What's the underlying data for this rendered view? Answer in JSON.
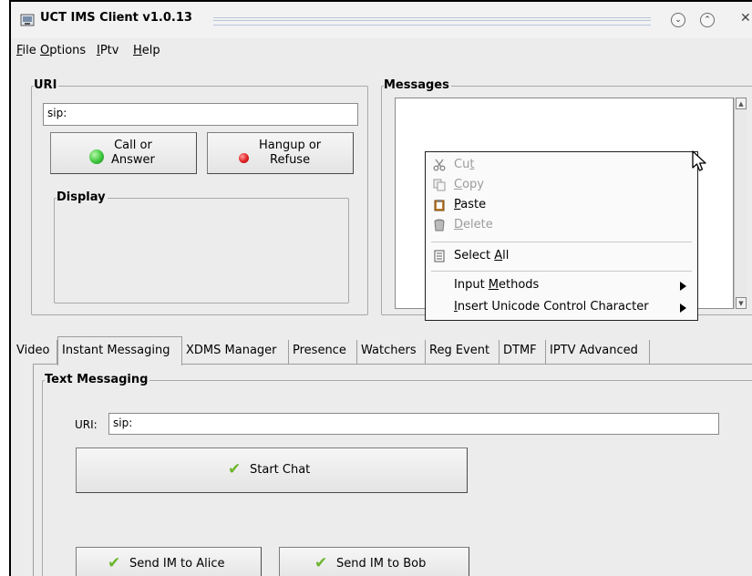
{
  "window": {
    "title": "UCT IMS Client v1.0.13"
  },
  "menubar": {
    "items": [
      {
        "label": "File",
        "mnemonic": "F",
        "rest": "ile"
      },
      {
        "label": "Options",
        "mnemonic": "O",
        "rest": "ptions"
      },
      {
        "label": "IPtv",
        "mnemonic": "I",
        "rest": "Ptv"
      },
      {
        "label": "Help",
        "mnemonic": "H",
        "rest": "elp"
      }
    ]
  },
  "uri_group": {
    "title": "URI",
    "uri_value": "sip:",
    "call_button": {
      "line1": "Call or",
      "line2": "Answer"
    },
    "hangup_button": {
      "line1": "Hangup or",
      "line2": "Refuse"
    },
    "display_title": "Display"
  },
  "messages_group": {
    "title": "Messages"
  },
  "context_menu": {
    "items": [
      {
        "pre": "Cu",
        "mn": "t",
        "post": "",
        "icon": "scissors-icon",
        "enabled": false
      },
      {
        "pre": "",
        "mn": "C",
        "post": "opy",
        "icon": "copy-icon",
        "enabled": false
      },
      {
        "pre": "",
        "mn": "P",
        "post": "aste",
        "icon": "clipboard-icon",
        "enabled": true
      },
      {
        "pre": "",
        "mn": "D",
        "post": "elete",
        "icon": "trash-icon",
        "enabled": false
      },
      {
        "pre": "Select ",
        "mn": "A",
        "post": "ll",
        "icon": "select-all-icon",
        "enabled": true
      },
      {
        "pre": "Input ",
        "mn": "M",
        "post": "ethods",
        "submenu": true,
        "enabled": true
      },
      {
        "pre": "",
        "mn": "I",
        "post": "nsert Unicode Control Character",
        "submenu": true,
        "enabled": true
      }
    ]
  },
  "tabs": [
    {
      "label": "Video",
      "active": false
    },
    {
      "label": "Instant Messaging",
      "active": true
    },
    {
      "label": "XDMS Manager",
      "active": false
    },
    {
      "label": "Presence",
      "active": false
    },
    {
      "label": "Watchers",
      "active": false
    },
    {
      "label": "Reg Event",
      "active": false
    },
    {
      "label": "DTMF",
      "active": false
    },
    {
      "label": "IPTV Advanced",
      "active": false
    }
  ],
  "text_messaging": {
    "title": "Text Messaging",
    "uri_label": "URI:",
    "uri_value": "sip:",
    "start_chat": "Start Chat",
    "send_alice": "Send IM to Alice",
    "send_bob": "Send IM to Bob"
  },
  "colors": {
    "call_led": "#3cc63c",
    "hangup_led": "#e02020",
    "check": "#6cb52d"
  }
}
